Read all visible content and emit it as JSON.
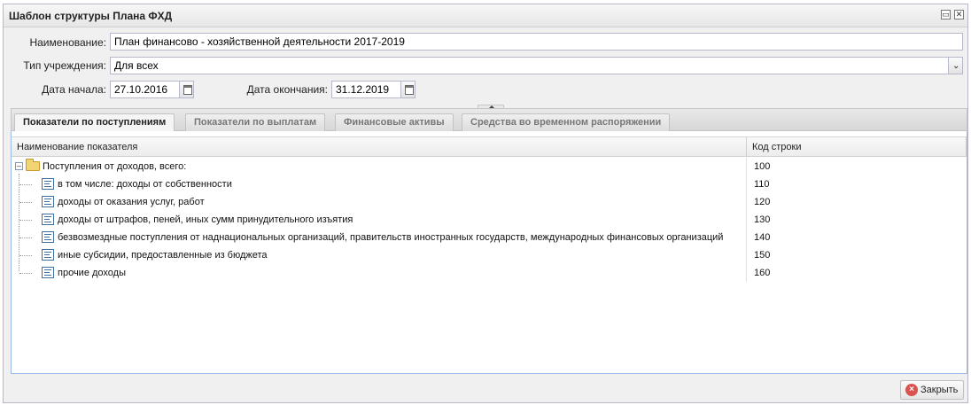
{
  "window": {
    "title": "Шаблон структуры Плана ФХД"
  },
  "form": {
    "name_label": "Наименование:",
    "name_value": "План финансово - хозяйственной деятельности  2017-2019",
    "type_label": "Тип учреждения:",
    "type_value": "Для всех",
    "start_label": "Дата начала:",
    "start_value": "27.10.2016",
    "end_label": "Дата окончания:",
    "end_value": "31.12.2019"
  },
  "tabs": [
    {
      "label": "Показатели по поступлениям",
      "active": true
    },
    {
      "label": "Показатели по выплатам",
      "active": false
    },
    {
      "label": "Финансовые активы",
      "active": false
    },
    {
      "label": "Средства во временном распоряжении",
      "active": false
    }
  ],
  "grid": {
    "col_name": "Наименование показателя",
    "col_code": "Код строки",
    "rows": [
      {
        "name": "Поступления от доходов, всего:",
        "code": "100",
        "type": "folder"
      },
      {
        "name": "в том числе: доходы от собственности",
        "code": "110",
        "type": "leaf"
      },
      {
        "name": "доходы от оказания услуг, работ",
        "code": "120",
        "type": "leaf"
      },
      {
        "name": "доходы от штрафов, пеней, иных сумм принудительного изъятия",
        "code": "130",
        "type": "leaf"
      },
      {
        "name": "безвозмездные поступления от наднациональных организаций, правительств иностранных государств, международных финансовых организаций",
        "code": "140",
        "type": "leaf"
      },
      {
        "name": "иные субсидии, предоставленные из бюджета",
        "code": "150",
        "type": "leaf"
      },
      {
        "name": "прочие доходы",
        "code": "160",
        "type": "leaf"
      }
    ]
  },
  "footer": {
    "close_label": "Закрыть"
  },
  "icons": {
    "maximize": "maximize-icon",
    "close": "close-icon",
    "calendar": "calendar-icon",
    "dropdown": "chevron-down-icon",
    "folder": "folder-icon",
    "leaf": "document-list-icon",
    "close_button": "close-circle-icon"
  },
  "colors": {
    "accent": "#99bbe8",
    "close_icon": "#d9534f",
    "folder": "#f3d472"
  }
}
